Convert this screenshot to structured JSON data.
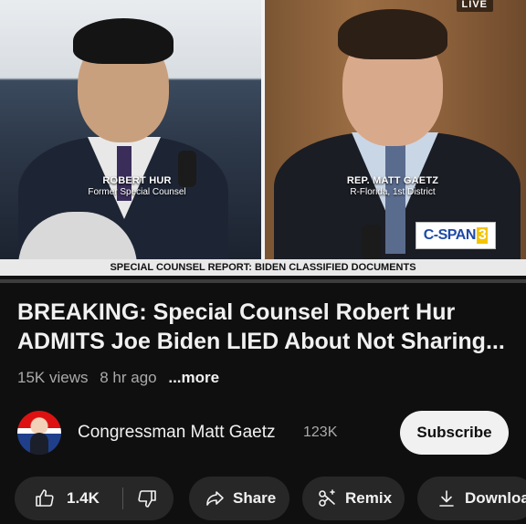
{
  "video": {
    "live_badge": "LIVE",
    "left_person": {
      "name": "ROBERT HUR",
      "title": "Former Special Counsel"
    },
    "right_person": {
      "name": "REP. MATT GAETZ",
      "title": "R-Florida, 1st District"
    },
    "network_logo": {
      "text": "C-SPAN",
      "suffix": "3"
    },
    "chyron": "SPECIAL COUNSEL REPORT: BIDEN CLASSIFIED DOCUMENTS",
    "progress_fraction": 0.0
  },
  "meta": {
    "title": "BREAKING: Special Counsel Robert Hur ADMITS Joe Biden LIED About Not Sharing...",
    "views": "15K views",
    "age": "8 hr ago",
    "more": "...more"
  },
  "channel": {
    "name": "Congressman Matt Gaetz",
    "subscribers": "123K",
    "subscribe_label": "Subscribe"
  },
  "actions": {
    "like_count": "1.4K",
    "share_label": "Share",
    "remix_label": "Remix",
    "download_label": "Downloa"
  },
  "colors": {
    "background": "#0f0f0f",
    "pill": "#272727",
    "subscribe_bg": "#f1f1f1",
    "secondary_text": "#aaaaaa",
    "progress_red": "#ff0000"
  }
}
